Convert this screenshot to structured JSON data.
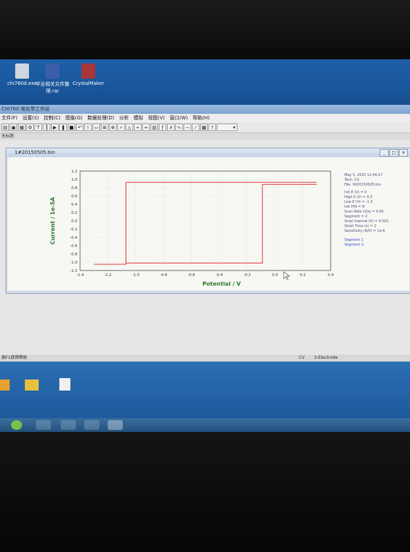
{
  "desktop_icons": [
    {
      "label": "chi760d.exe"
    },
    {
      "label": "毕业相关文件整理.rar"
    },
    {
      "label": "CrystalMaker"
    }
  ],
  "window": {
    "title": "CHI760 电化学工作站",
    "menu": [
      "文件(F)",
      "设置(S)",
      "控制(C)",
      "图像(G)",
      "数据处理(D)",
      "分析",
      "模拟",
      "视图(V)",
      "窗口(W)",
      "帮助(H)"
    ],
    "status_tab": "无标题",
    "status_left": "按F1获得帮助",
    "status_mode": "CV",
    "status_electrode": "3-Electrode"
  },
  "document": {
    "title": "1#20150505.bin"
  },
  "info_panel": {
    "date": "May 5, 2015   11:04:17",
    "tech": "Tech: CV",
    "file": "File: 0420150505.bin",
    "params": [
      "Init E (V) = 0",
      "High E (V) = 0.3",
      "Low E (V) = -1.3",
      "Init P/N = N",
      "Scan Rate (V/s) = 0.05",
      "Segment = 2",
      "Smpl Interval (V) = 0.001",
      "Quiet Time (s) = 2",
      "Sensitivity (A/V) = 1e-6"
    ],
    "segments": [
      "Segment 1:",
      "Segment 2:"
    ]
  },
  "chart_data": {
    "type": "line",
    "xlabel": "Potential / V",
    "ylabel": "Current / 1e-5A",
    "xlim": [
      -1.4,
      0.4
    ],
    "ylim": [
      -1.2,
      1.2
    ],
    "xticks": [
      "-1.4",
      "-1.2",
      "-1.0",
      "-0.8",
      "-0.6",
      "-0.4",
      "-0.2",
      "0.0",
      "0.2",
      "0.4"
    ],
    "yticks": [
      "1.2",
      "1.0",
      "0.8",
      "0.6",
      "0.4",
      "0.2",
      "0.0",
      "-0.2",
      "-0.4",
      "-0.6",
      "-0.8",
      "-1.0",
      "-1.2"
    ],
    "grid": true,
    "line_color": "#e03030",
    "series": [
      {
        "x": [
          -1.3,
          -1.07,
          -1.07,
          0.3
        ],
        "y": [
          -1.05,
          -1.05,
          0.93,
          0.93
        ]
      },
      {
        "x": [
          0.3,
          -0.09,
          -0.09,
          -1.07
        ],
        "y": [
          0.88,
          0.88,
          -1.02,
          -1.02
        ]
      }
    ]
  }
}
